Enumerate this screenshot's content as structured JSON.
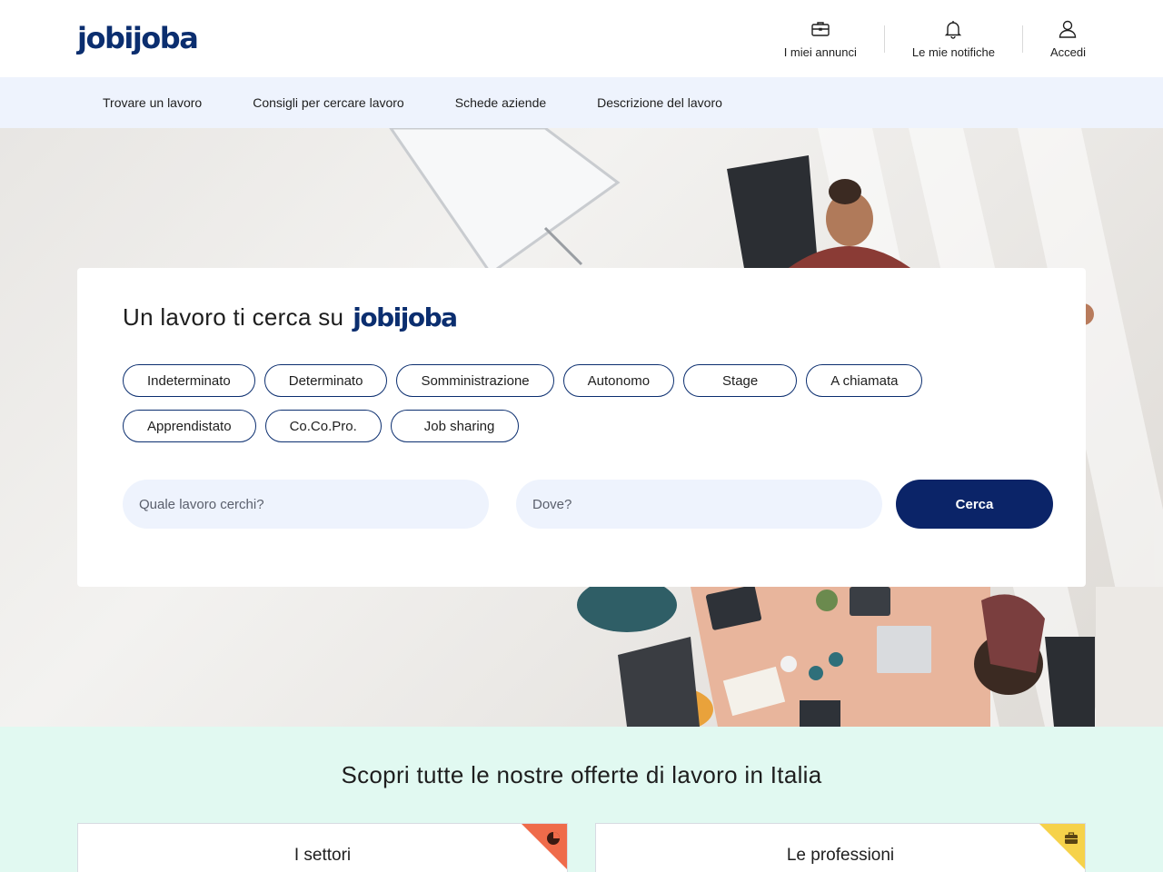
{
  "brand": {
    "name": "jobijoba",
    "color": "#0b2e6f"
  },
  "header": {
    "actions": [
      {
        "label": "I miei annunci",
        "icon": "briefcase-icon"
      },
      {
        "label": "Le mie notifiche",
        "icon": "bell-icon"
      },
      {
        "label": "Accedi",
        "icon": "user-icon"
      }
    ]
  },
  "nav": {
    "items": [
      "Trovare un lavoro",
      "Consigli per cercare lavoro",
      "Schede aziende",
      "Descrizione del lavoro"
    ]
  },
  "search": {
    "title": "Un lavoro ti cerca su",
    "brand": "jobijoba",
    "contract_types": [
      "Indeterminato",
      "Determinato",
      "Somministrazione",
      "Autonomo",
      "Stage",
      "A chiamata",
      "Apprendistato",
      "Co.Co.Pro.",
      "Job sharing"
    ],
    "what_placeholder": "Quale lavoro cerchi?",
    "where_placeholder": "Dove?",
    "button_label": "Cerca",
    "button_color": "#0b2468"
  },
  "offers": {
    "title": "Scopri tutte le nostre offerte di lavoro in Italia",
    "cards": [
      {
        "label": "I settori",
        "icon": "pie-chart-icon",
        "accent": "#ef6b4a"
      },
      {
        "label": "Le professioni",
        "icon": "briefcase-icon",
        "accent": "#f6d24a"
      }
    ]
  },
  "colors": {
    "nav_bg": "#eef3fd",
    "offers_bg": "#e1f9f1"
  }
}
